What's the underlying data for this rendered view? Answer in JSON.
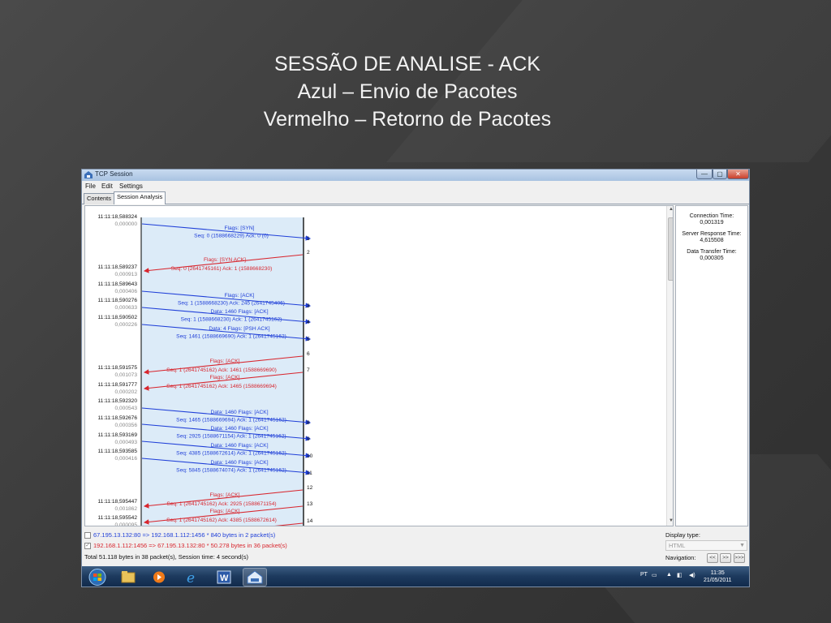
{
  "slide": {
    "title_lines": [
      "SESSÃO DE ANALISE - ACK",
      "Azul – Envio de Pacotes",
      "Vermelho – Retorno de Pacotes"
    ]
  },
  "window": {
    "title": "TCP Session",
    "menu": [
      "File",
      "Edit",
      "Settings"
    ],
    "tabs": [
      "Contents",
      "Session Analysis"
    ],
    "active_tab": 1,
    "controls": {
      "minimize": "—",
      "maximize": "▢",
      "close": "✕"
    }
  },
  "colors": {
    "send": "#1f3fd8",
    "return": "#d8262e",
    "axis": "#000000",
    "column_bg": "#dcebf8"
  },
  "timestamps": [
    {
      "time": "11:11:18,588324",
      "delta": "0,000000"
    },
    {
      "time": "11:11:18,589237",
      "delta": "0,000913"
    },
    {
      "time": "11:11:18,589643",
      "delta": "0,000406"
    },
    {
      "time": "11:11:18,590276",
      "delta": "0,000633"
    },
    {
      "time": "11:11:18,590502",
      "delta": "0,000226"
    },
    {
      "time": "11:11:18,591575",
      "delta": "0,001073"
    },
    {
      "time": "11:11:18,591777",
      "delta": "0,000202"
    },
    {
      "time": "11:11:18,592320",
      "delta": "0,000543"
    },
    {
      "time": "11:11:18,592676",
      "delta": "0,000356"
    },
    {
      "time": "11:11:18,593169",
      "delta": "0,000493"
    },
    {
      "time": "11:11:18,593585",
      "delta": "0,000416"
    },
    {
      "time": "11:11:18,595447",
      "delta": "0,001862"
    },
    {
      "time": "11:11:18,595542",
      "delta": "0,000095"
    }
  ],
  "packets": [
    {
      "dir": "send",
      "flags": "Flags: [SYN]",
      "seq": "Seq: 0 (1588668229) Ack: 0 (0)",
      "num": "1"
    },
    {
      "dir": "return",
      "flags": "Flags: [SYN ACK]",
      "seq": "Seq: 0 (2641745161) Ack: 1 (1588668230)",
      "num": "2"
    },
    {
      "dir": "send",
      "flags": "Flags: [ACK]",
      "seq": "Seq: 1 (1588668230) Ack: 245 (2641745406)",
      "num": "3"
    },
    {
      "dir": "send",
      "flags": "Data: 1460 Flags: [ACK]",
      "seq": "Seq: 1 (1588668230) Ack: 1 (2641745162)",
      "num": "4"
    },
    {
      "dir": "send",
      "flags": "Data: 4 Flags: [PSH ACK]",
      "seq": "Seq: 1461 (1588669690) Ack: 1 (2641745162)",
      "num": "5"
    },
    {
      "dir": "return",
      "flags": "Flags: [ACK]",
      "seq": "Seq: 1 (2641745162) Ack: 1461 (1588669690)",
      "num": "6"
    },
    {
      "dir": "return",
      "flags": "Flags: [ACK]",
      "seq": "Seq: 1 (2641745162) Ack: 1465 (1588669694)",
      "num": "7"
    },
    {
      "dir": "send",
      "flags": "Data: 1460 Flags: [ACK]",
      "seq": "Seq: 1465 (1588669694) Ack: 1 (2641745162)",
      "num": "8"
    },
    {
      "dir": "send",
      "flags": "Data: 1460 Flags: [ACK]",
      "seq": "Seq: 2925 (1588671154) Ack: 1 (2641745162)",
      "num": "9"
    },
    {
      "dir": "send",
      "flags": "Data: 1460 Flags: [ACK]",
      "seq": "Seq: 4385 (1588672614) Ack: 1 (2641745162)",
      "num": "10"
    },
    {
      "dir": "send",
      "flags": "Data: 1460 Flags: [ACK]",
      "seq": "Seq: 5845 (1588674074) Ack: 1 (2641745162)",
      "num": "11"
    },
    {
      "dir": "return",
      "flags": "Flags: [ACK]",
      "seq": "Seq: 1 (2641745162) Ack: 2925 (1588671154)",
      "num": "12"
    },
    {
      "dir": "return",
      "flags": "Flags: [ACK]",
      "seq": "Seq: 1 (2641745162) Ack: 4385 (1588672614)",
      "num": "13"
    },
    {
      "dir": "return",
      "flags": "Flags: [ACK]",
      "seq": "",
      "num": "14"
    }
  ],
  "stats": [
    {
      "label": "Connection Time:",
      "value": "0,001319"
    },
    {
      "label": "Server Response Time:",
      "value": "4,615508"
    },
    {
      "label": "Data Transfer Time:",
      "value": "0,000305"
    }
  ],
  "flows": {
    "row1": {
      "text": "67.195.13.132:80 => 192.168.1.112:1456 * 840 bytes in 2 packet(s)",
      "checked": false,
      "color": "#1f3fd8"
    },
    "row2": {
      "text": "192.168.1.112:1456 => 67.195.13.132:80 * 50.278 bytes in 36 packet(s)",
      "checked": true,
      "color": "#d8262e"
    },
    "total": "Total 51.118 bytes in 38 packet(s), Session time: 4 second(s)"
  },
  "display": {
    "label": "Display type:",
    "value": "HTML",
    "navigation_label": "Navigation:",
    "nav_buttons": [
      "<<",
      ">>",
      ">>>"
    ]
  },
  "taskbar": {
    "language": "PT",
    "time": "11:35",
    "date": "21/05/2011",
    "apps": [
      "start-orb",
      "file-explorer",
      "media-player",
      "internet-explorer",
      "word",
      "tcp-session-app"
    ]
  }
}
